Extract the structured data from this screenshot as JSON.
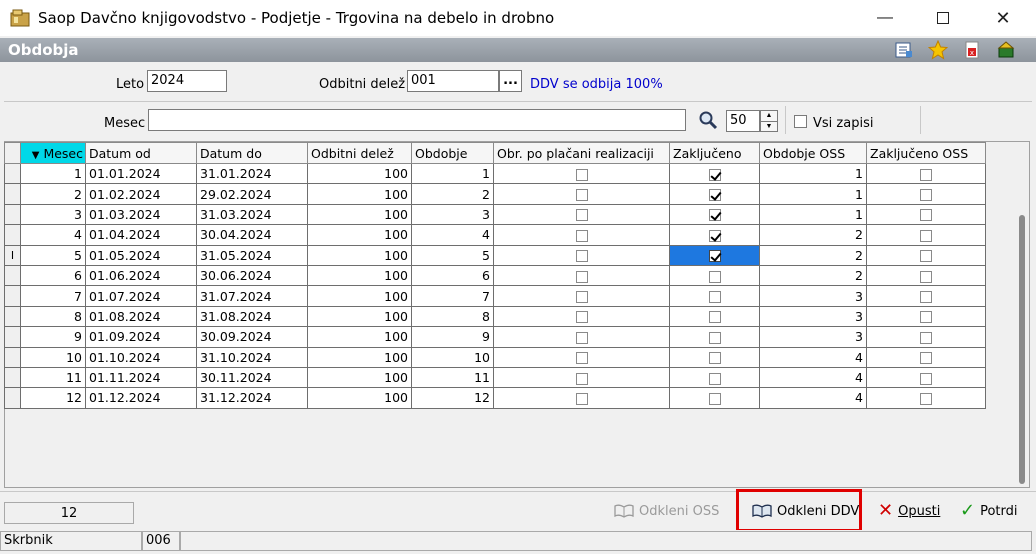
{
  "window": {
    "title": "Saop Davčno knjigovodstvo - Podjetje - Trgovina na debelo in drobno"
  },
  "section": {
    "title": "Obdobja"
  },
  "form": {
    "leto_label": "Leto",
    "leto_value": "2024",
    "odbitni_label": "Odbitni delež",
    "odbitni_value": "001",
    "browse_label": "...",
    "ddv_info": "DDV se odbija 100%",
    "mesec_label": "Mesec",
    "mesec_value": "",
    "count_value": "50",
    "vsi_label": "Vsi zapisi"
  },
  "table": {
    "columns": [
      "Mesec",
      "Datum od",
      "Datum do",
      "Odbitni delež",
      "Obdobje",
      "Obr. po plačani realizaciji",
      "Zaključeno",
      "Obdobje OSS",
      "Zaključeno OSS"
    ],
    "rows": [
      {
        "mesec": "1",
        "od": "01.01.2024",
        "do": "31.01.2024",
        "delez": "100",
        "obdobje": "1",
        "obr": false,
        "zak": true,
        "oss": "1",
        "zoss": false
      },
      {
        "mesec": "2",
        "od": "01.02.2024",
        "do": "29.02.2024",
        "delez": "100",
        "obdobje": "2",
        "obr": false,
        "zak": true,
        "oss": "1",
        "zoss": false
      },
      {
        "mesec": "3",
        "od": "01.03.2024",
        "do": "31.03.2024",
        "delez": "100",
        "obdobje": "3",
        "obr": false,
        "zak": true,
        "oss": "1",
        "zoss": false
      },
      {
        "mesec": "4",
        "od": "01.04.2024",
        "do": "30.04.2024",
        "delez": "100",
        "obdobje": "4",
        "obr": false,
        "zak": true,
        "oss": "2",
        "zoss": false
      },
      {
        "mesec": "5",
        "od": "01.05.2024",
        "do": "31.05.2024",
        "delez": "100",
        "obdobje": "5",
        "obr": false,
        "zak": true,
        "oss": "2",
        "zoss": false
      },
      {
        "mesec": "6",
        "od": "01.06.2024",
        "do": "30.06.2024",
        "delez": "100",
        "obdobje": "6",
        "obr": false,
        "zak": false,
        "oss": "2",
        "zoss": false
      },
      {
        "mesec": "7",
        "od": "01.07.2024",
        "do": "31.07.2024",
        "delez": "100",
        "obdobje": "7",
        "obr": false,
        "zak": false,
        "oss": "3",
        "zoss": false
      },
      {
        "mesec": "8",
        "od": "01.08.2024",
        "do": "31.08.2024",
        "delez": "100",
        "obdobje": "8",
        "obr": false,
        "zak": false,
        "oss": "3",
        "zoss": false
      },
      {
        "mesec": "9",
        "od": "01.09.2024",
        "do": "30.09.2024",
        "delez": "100",
        "obdobje": "9",
        "obr": false,
        "zak": false,
        "oss": "3",
        "zoss": false
      },
      {
        "mesec": "10",
        "od": "01.10.2024",
        "do": "31.10.2024",
        "delez": "100",
        "obdobje": "10",
        "obr": false,
        "zak": false,
        "oss": "4",
        "zoss": false
      },
      {
        "mesec": "11",
        "od": "01.11.2024",
        "do": "30.11.2024",
        "delez": "100",
        "obdobje": "11",
        "obr": false,
        "zak": false,
        "oss": "4",
        "zoss": false
      },
      {
        "mesec": "12",
        "od": "01.12.2024",
        "do": "31.12.2024",
        "delez": "100",
        "obdobje": "12",
        "obr": false,
        "zak": false,
        "oss": "4",
        "zoss": false
      }
    ],
    "current_row_index": 4,
    "current_row_marker": "I",
    "sort_arrow": "▼"
  },
  "bottom": {
    "record_count": "12",
    "odkleni_oss": "Odkleni OSS",
    "odkleni_ddv": "Odkleni DDV",
    "opusti": "Opusti",
    "potrdi": "Potrdi"
  },
  "status": {
    "user": "Skrbnik",
    "code": "006"
  },
  "colors": {
    "highlight_border": "#e00000",
    "selected_cell": "#1e78e0",
    "sort_header": "#00d8e8",
    "info_text": "#0000cc"
  },
  "icons": [
    "app-icon",
    "minimize-icon",
    "maximize-icon",
    "close-icon",
    "list-settings-icon",
    "favorite-star-icon",
    "export-document-icon",
    "exit-door-icon",
    "search-icon",
    "spin-up-icon",
    "spin-down-icon",
    "unlock-book-icon",
    "cancel-x-icon",
    "confirm-check-icon"
  ]
}
